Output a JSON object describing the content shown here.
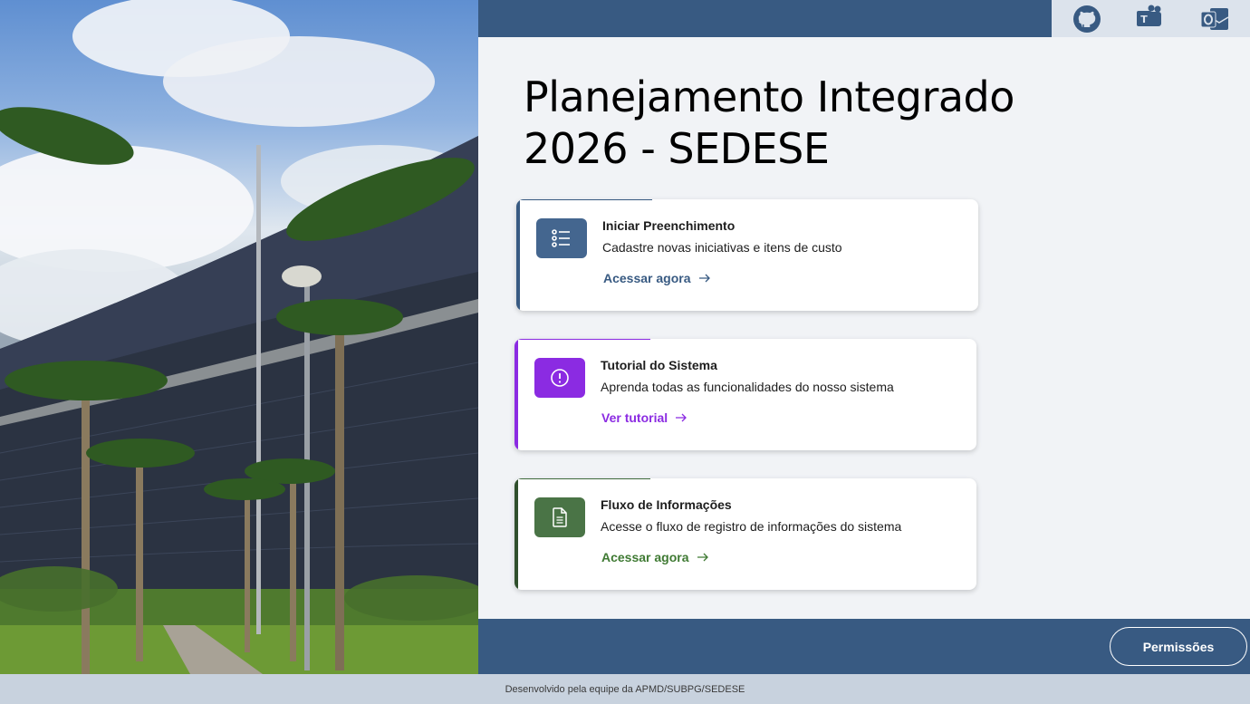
{
  "page": {
    "title": "Planejamento Integrado 2026 - SEDESE"
  },
  "header_icons": [
    {
      "name": "github-icon",
      "color": "#385a82"
    },
    {
      "name": "teams-icon",
      "color": "#385a82"
    },
    {
      "name": "outlook-icon",
      "color": "#385a82"
    }
  ],
  "cards": [
    {
      "title": "Iniciar Preenchimento",
      "description": "Cadastre novas iniciativas e itens de custo",
      "link": "Acessar agora",
      "icon": "list-icon",
      "color": "#385a82"
    },
    {
      "title": "Tutorial do Sistema",
      "description": "Aprenda todas as funcionalidades do nosso sistema",
      "link": "Ver tutorial",
      "icon": "info-circle-icon",
      "color": "#8b2be2"
    },
    {
      "title": "Fluxo de Informações",
      "description": "Acesse o fluxo de registro de informações do sistema",
      "link": "Acessar agora",
      "icon": "document-icon",
      "color": "#3f6b3c"
    }
  ],
  "bottombar": {
    "permissions_label": "Permissões"
  },
  "footer": {
    "text": "Desenvolvido pela equipe da APMD/SUBPG/SEDESE"
  },
  "colors": {
    "primary": "#385a82",
    "background": "#f1f3f6",
    "footer": "#c8d2de"
  }
}
